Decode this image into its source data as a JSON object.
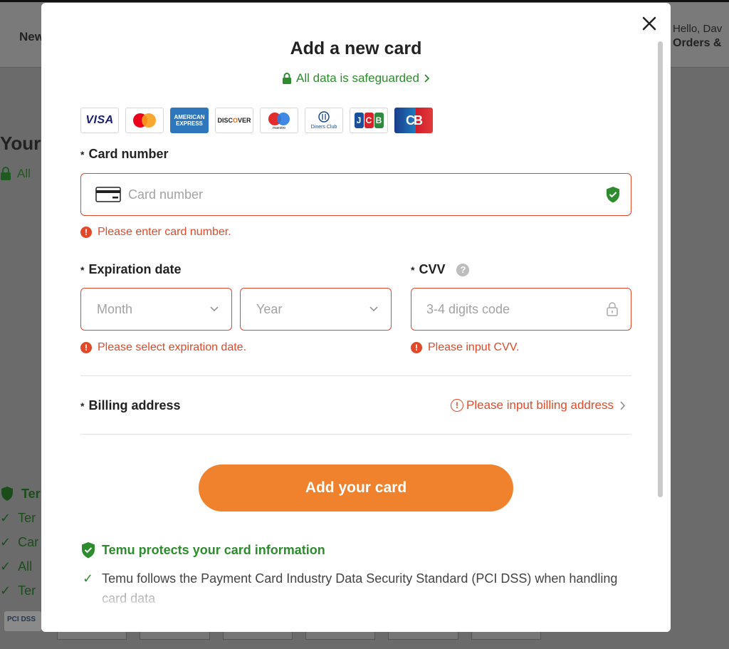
{
  "background": {
    "nav_new": "New",
    "greeting": "Hello, Dav",
    "orders": "Orders &",
    "your_heading": "Your",
    "all_text": "All",
    "list_heading": "Ter",
    "list_items": [
      "Ter",
      "Car",
      "All",
      "Ter"
    ],
    "pci_badge": "PCI DSS"
  },
  "modal": {
    "title": "Add a new card",
    "safeguard": "All data is safeguarded",
    "card_brands": [
      "VISA",
      "Mastercard",
      "American Express",
      "Discover",
      "Maestro",
      "Diners Club International",
      "JCB",
      "CB"
    ],
    "card_number": {
      "label": "Card number",
      "placeholder": "Card number",
      "error": "Please enter card number."
    },
    "expiration": {
      "label": "Expiration date",
      "month_placeholder": "Month",
      "year_placeholder": "Year",
      "error": "Please select expiration date."
    },
    "cvv": {
      "label": "CVV",
      "placeholder": "3-4 digits code",
      "error": "Please input CVV."
    },
    "billing": {
      "label": "Billing address",
      "error": "Please input billing address"
    },
    "submit_label": "Add your card",
    "protection": {
      "title": "Temu protects your card information",
      "item": "Temu follows the Payment Card Industry Data Security Standard (PCI DSS) when handling card data"
    },
    "colors": {
      "accent": "#f0812d",
      "error": "#e04a2b",
      "success": "#2e8b2e"
    }
  }
}
